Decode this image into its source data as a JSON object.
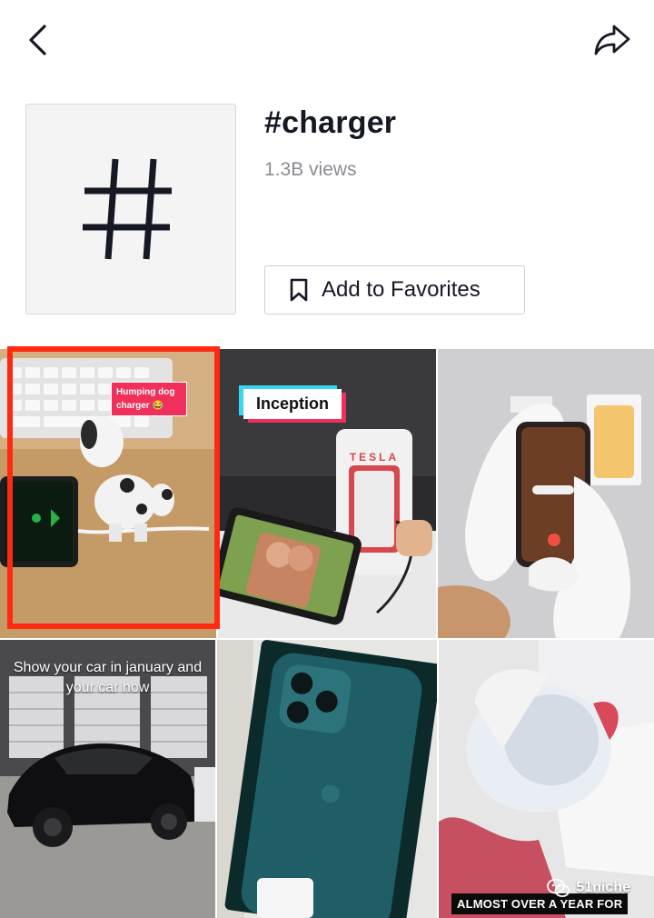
{
  "header": {
    "back_icon": "chevron-left-icon",
    "share_icon": "share-arrow-icon"
  },
  "hashtag": {
    "title": "#charger",
    "views": "1.3B views",
    "thumbnail_icon": "hashtag-icon",
    "favorite_button": {
      "label": "Add to Favorites",
      "icon": "bookmark-icon"
    }
  },
  "videos": [
    {
      "overlay_text": "Humping dog charger 😂",
      "highlighted": true
    },
    {
      "overlay_text": "Inception",
      "brand_text": "TESLA"
    },
    {
      "overlay_text": ""
    },
    {
      "overlay_text": "Show your car in january and your car now"
    },
    {
      "overlay_text": ""
    },
    {
      "overlay_text": "ALMOST OVER A YEAR FOR"
    }
  ],
  "watermark": {
    "text": "51niche",
    "icon": "wechat-icon"
  },
  "colors": {
    "highlight": "#ff2a12",
    "accent_pink": "#f0305a",
    "accent_cyan": "#37d7f0"
  }
}
